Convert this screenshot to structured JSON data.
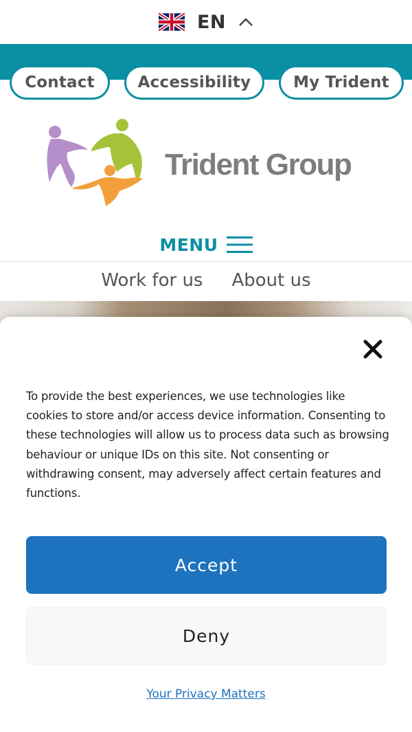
{
  "language": {
    "code": "EN",
    "flag_icon": "uk-flag-icon",
    "caret_icon": "chevron-up-icon"
  },
  "top_links": {
    "contact": "Contact",
    "accessibility": "Accessibility",
    "my_trident": "My Trident"
  },
  "logo": {
    "text": "Trident Group"
  },
  "menu": {
    "label": "MENU",
    "icon": "hamburger-icon"
  },
  "secondary_nav": {
    "items": [
      "Work for us",
      "About us"
    ]
  },
  "cookie_modal": {
    "close_icon": "close-icon",
    "text": "To provide the best experiences, we use technologies like cookies to store and/or access device information. Consenting to these technologies will allow us to process data such as browsing behaviour or unique IDs on this site. Not consenting or withdrawing consent, may adversely affect certain features and functions.",
    "accept_label": "Accept",
    "deny_label": "Deny",
    "privacy_link": "Your Privacy Matters"
  },
  "colors": {
    "teal": "#0b8fa3",
    "accept_blue": "#1e73be",
    "logo_grey": "#7d7d7d",
    "figure_purple": "#b48fc9",
    "figure_green": "#a6c23a",
    "figure_orange": "#f2a03d"
  }
}
